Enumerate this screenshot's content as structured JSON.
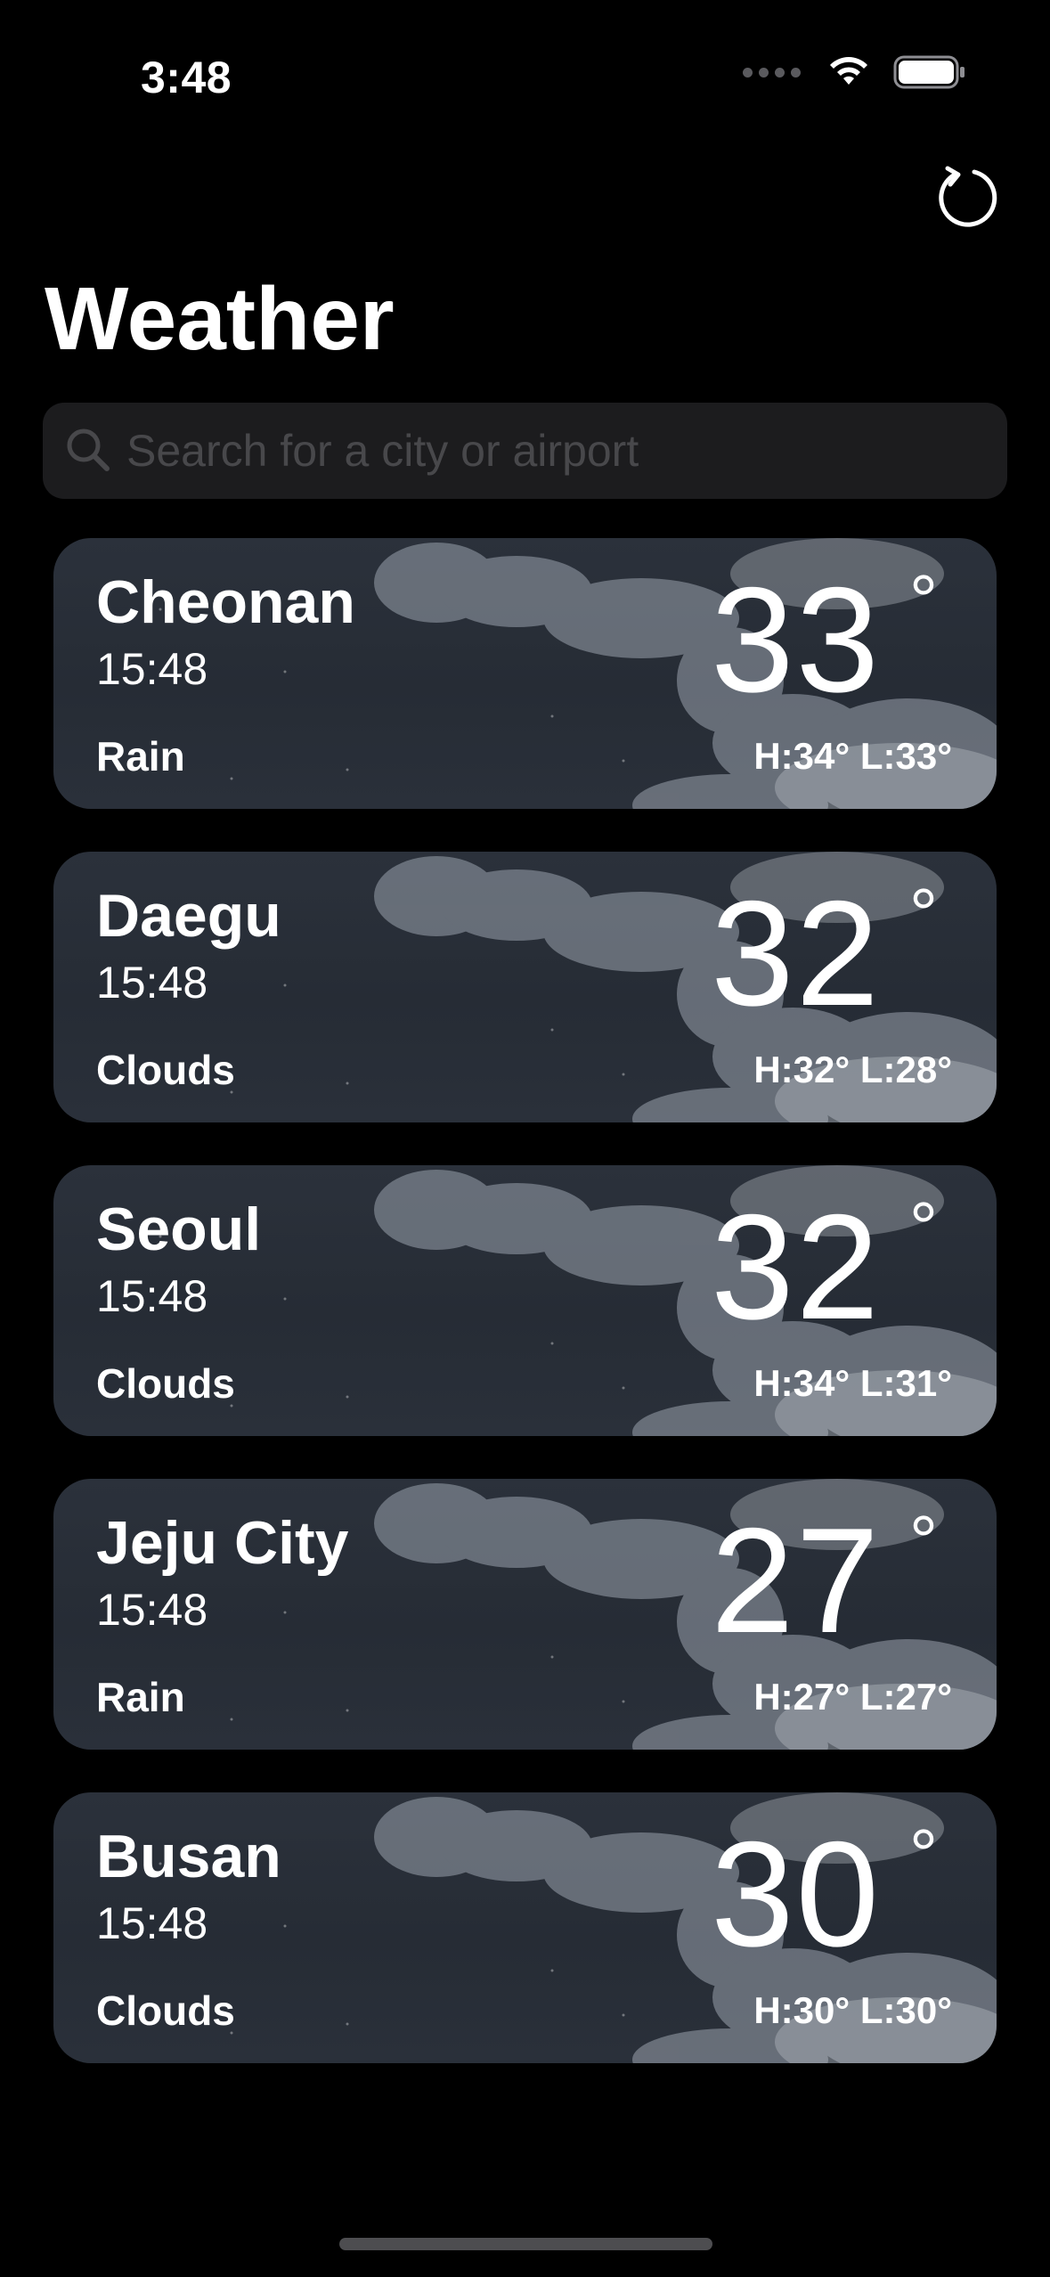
{
  "status_bar": {
    "time": "3:48"
  },
  "header": {
    "title": "Weather"
  },
  "search": {
    "placeholder": "Search for a city or airport"
  },
  "cities": [
    {
      "city": "Cheonan",
      "time": "15:48",
      "condition": "Rain",
      "temp": "33",
      "degree": "°",
      "high_low": "H:34° L:33°"
    },
    {
      "city": "Daegu",
      "time": "15:48",
      "condition": "Clouds",
      "temp": "32",
      "degree": "°",
      "high_low": "H:32° L:28°"
    },
    {
      "city": "Seoul",
      "time": "15:48",
      "condition": "Clouds",
      "temp": "32",
      "degree": "°",
      "high_low": "H:34° L:31°"
    },
    {
      "city": "Jeju City",
      "time": "15:48",
      "condition": "Rain",
      "temp": "27",
      "degree": "°",
      "high_low": "H:27° L:27°"
    },
    {
      "city": "Busan",
      "time": "15:48",
      "condition": "Clouds",
      "temp": "30",
      "degree": "°",
      "high_low": "H:30° L:30°"
    }
  ],
  "icons": {
    "refresh": "refresh-icon",
    "search": "search-icon",
    "wifi": "wifi-icon",
    "battery": "battery-icon"
  },
  "colors": {
    "background": "#000000",
    "search_field": "#1c1c1e",
    "placeholder": "#48484b",
    "card": "#2a303a"
  }
}
